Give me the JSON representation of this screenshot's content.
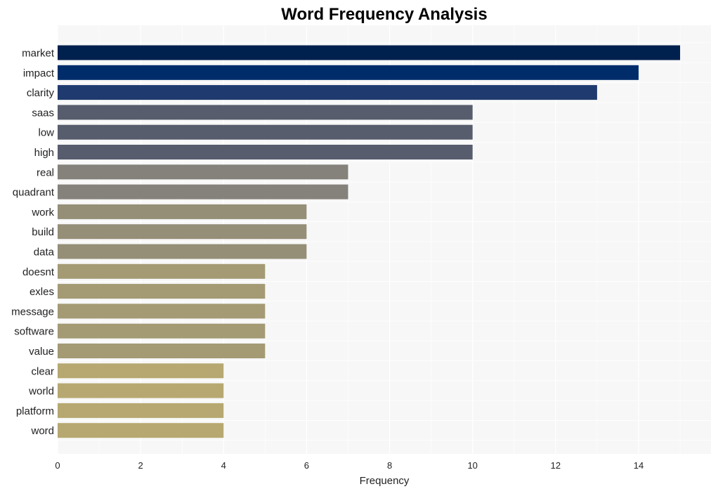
{
  "chart_data": {
    "type": "bar",
    "orientation": "horizontal",
    "title": "Word Frequency Analysis",
    "xlabel": "Frequency",
    "ylabel": "",
    "xlim": [
      0,
      15.75
    ],
    "xticks": [
      0,
      2,
      4,
      6,
      8,
      10,
      12,
      14
    ],
    "grid": true,
    "legend": "none",
    "categories": [
      "market",
      "impact",
      "clarity",
      "saas",
      "low",
      "high",
      "real",
      "quadrant",
      "work",
      "build",
      "data",
      "doesnt",
      "exles",
      "message",
      "software",
      "value",
      "clear",
      "world",
      "platform",
      "word"
    ],
    "values": [
      15,
      14,
      13,
      10,
      10,
      10,
      7,
      7,
      6,
      6,
      6,
      5,
      5,
      5,
      5,
      5,
      4,
      4,
      4,
      4
    ],
    "colors": [
      "#00204e",
      "#002d6a",
      "#1f3a6e",
      "#575d6d",
      "#575d6d",
      "#575d6d",
      "#84827a",
      "#84827a",
      "#958f78",
      "#958f78",
      "#958f78",
      "#a49a74",
      "#a49a74",
      "#a49a74",
      "#a49a74",
      "#a49a74",
      "#b6a870",
      "#b6a870",
      "#b6a870",
      "#b6a870"
    ]
  }
}
